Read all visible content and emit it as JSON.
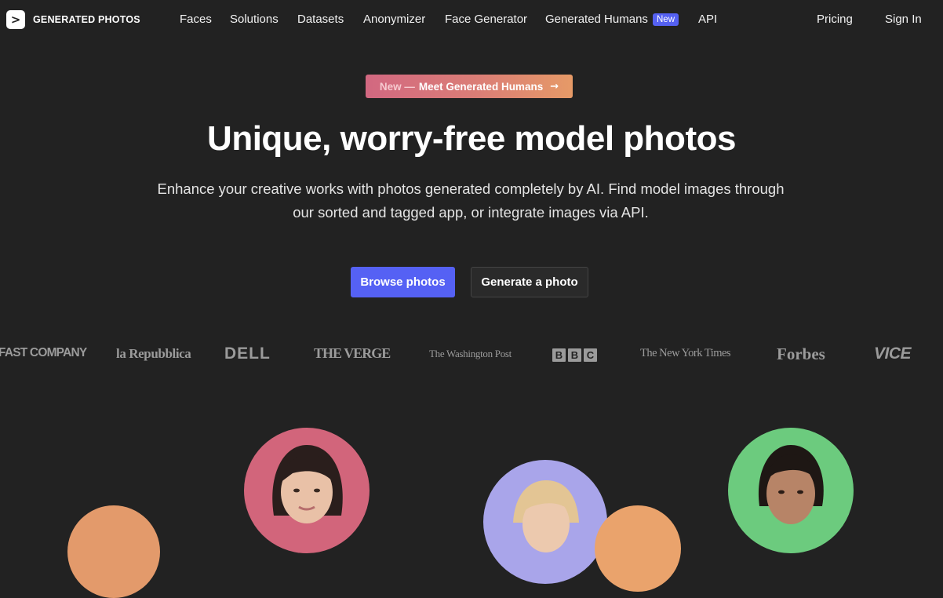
{
  "brand": {
    "name": "GENERATED PHOTOS",
    "mark": ">"
  },
  "nav": {
    "items": [
      {
        "label": "Faces"
      },
      {
        "label": "Solutions"
      },
      {
        "label": "Datasets"
      },
      {
        "label": "Anonymizer"
      },
      {
        "label": "Face Generator"
      },
      {
        "label": "Generated Humans"
      },
      {
        "label": "API"
      }
    ],
    "new_badge": "New",
    "pricing": "Pricing",
    "sign_in": "Sign In"
  },
  "announcement": {
    "prefix": "New —",
    "title": "Meet Generated Humans",
    "arrow": "→"
  },
  "hero": {
    "headline": "Unique, worry-free model photos",
    "subtitle": "Enhance your creative works with photos generated completely by AI. Find model images through our sorted and tagged app, or integrate images via API.",
    "primary_cta": "Browse photos",
    "secondary_cta": "Generate a photo"
  },
  "press_logos": [
    {
      "name": "FAST COMPANY",
      "text": "FAST COMPANY"
    },
    {
      "name": "la Repubblica",
      "text": "la Repubblica"
    },
    {
      "name": "DELL",
      "text": "DELL"
    },
    {
      "name": "THE VERGE",
      "text": "THE VERGE"
    },
    {
      "name": "The Washington Post",
      "text": "The Washington Post"
    },
    {
      "name": "BBC",
      "letters": [
        "B",
        "B",
        "C"
      ]
    },
    {
      "name": "The New York Times",
      "text": "The New York Times"
    },
    {
      "name": "Forbes",
      "text": "Forbes"
    },
    {
      "name": "VICE",
      "text": "VICE"
    }
  ],
  "colors": {
    "background": "#222222",
    "accent": "#5561f4",
    "announcement_gradient": [
      "#d26881",
      "#e69a67"
    ],
    "press_logo": "#9b9b9b",
    "face_backgrounds": [
      "#e39a6b",
      "#d2657b",
      "#a9a5ea",
      "#eaa36c",
      "#6ccb7e"
    ]
  }
}
